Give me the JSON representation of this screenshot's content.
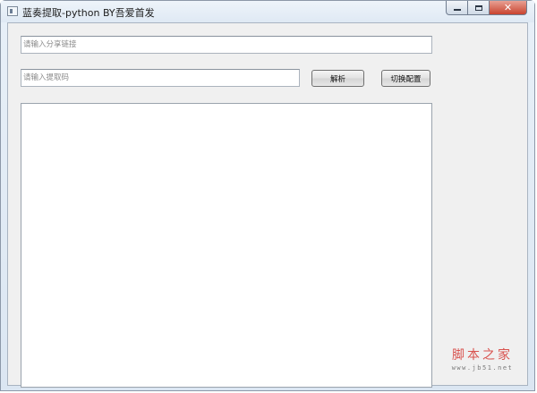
{
  "window": {
    "title": "蓝奏提取-python BY吾爱首发",
    "icon": "app-window-icon",
    "controls": {
      "minimize": "minimize-icon",
      "maximize": "maximize-icon",
      "close": "close-icon",
      "close_glyph": "✕"
    }
  },
  "form": {
    "share_link": {
      "value": "",
      "placeholder": "请输入分享链接"
    },
    "extract_code": {
      "value": "",
      "placeholder": "请输入提取码"
    },
    "parse_button": "解析",
    "switch_config_button": "切换配置"
  },
  "output": {
    "text": ""
  },
  "watermark": {
    "main": "脚本之家",
    "url": "www.jb51.net"
  },
  "colors": {
    "watermark": "#d9534f",
    "close_button": "#c9432f"
  }
}
